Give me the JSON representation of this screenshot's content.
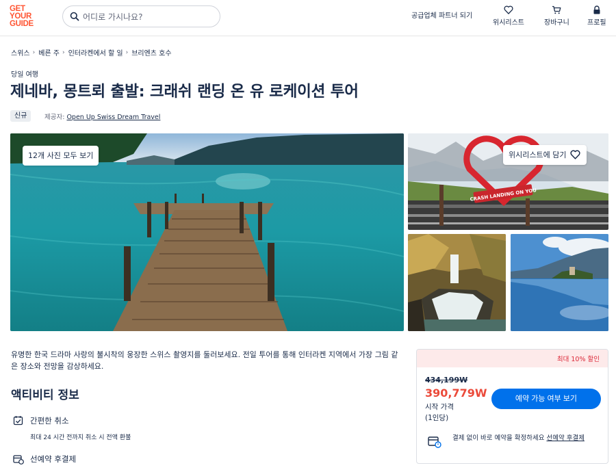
{
  "header": {
    "logo_lines": [
      "GET",
      "YOUR",
      "GUIDE"
    ],
    "search_placeholder": "어디로 가시나요?",
    "partner_link": "공급업체 파트너 되기",
    "nav": [
      {
        "label": "위시리스트",
        "icon": "heart-icon"
      },
      {
        "label": "장바구니",
        "icon": "cart-icon"
      },
      {
        "label": "프로필",
        "icon": "lock-icon"
      }
    ]
  },
  "breadcrumb": [
    "스위스",
    "베른 주",
    "인터라켄에서 할 일",
    "브리엔츠 호수"
  ],
  "product": {
    "category": "당일 여행",
    "title": "제네바, 몽트뢰 출발: 크래쉬 랜딩 온 유 로케이션 투어",
    "badge": "신규",
    "provider_label": "제공자:",
    "provider_name": "Open Up Swiss Dream Travel"
  },
  "gallery": {
    "view_all": "12개 사진 모두 보기",
    "wishlist": "위시리스트에 담기",
    "sign_text": "CRASH LANDING ON YOU"
  },
  "description": "유명한 한국 드라마 사랑의 불시착의 웅장한 스위스 촬영지를 둘러보세요. 전일 투어를 통해 인터라켄 지역에서 가장 그림 같은 장소와 전망을 감상하세요.",
  "activity": {
    "section_title": "액티비티 정보",
    "features": [
      {
        "title": "간편한 취소",
        "subtitle": "최대 24 시간 전까지 취소 시 전액 환불",
        "icon": "calendar-check-icon"
      },
      {
        "title": "선예약 후결제",
        "subtitle": "",
        "icon": "calendar-card-icon"
      }
    ]
  },
  "booking": {
    "discount": "최대 10% 할인",
    "old_price": "434,199W",
    "new_price": "390,779W",
    "from_label": "시작 가격",
    "per_person": "(1인당)",
    "cta": "예약 가능 여부 보기",
    "reserve_text": "결제 없이 바로 예약을 확정하세요 ",
    "reserve_link": "선예약 후결제"
  },
  "colors": {
    "brand": "#ff5533",
    "primary_button": "#0071eb",
    "sale_price": "#eb4a3a",
    "discount_bg": "#fdeaea",
    "text": "#1a2b49"
  }
}
